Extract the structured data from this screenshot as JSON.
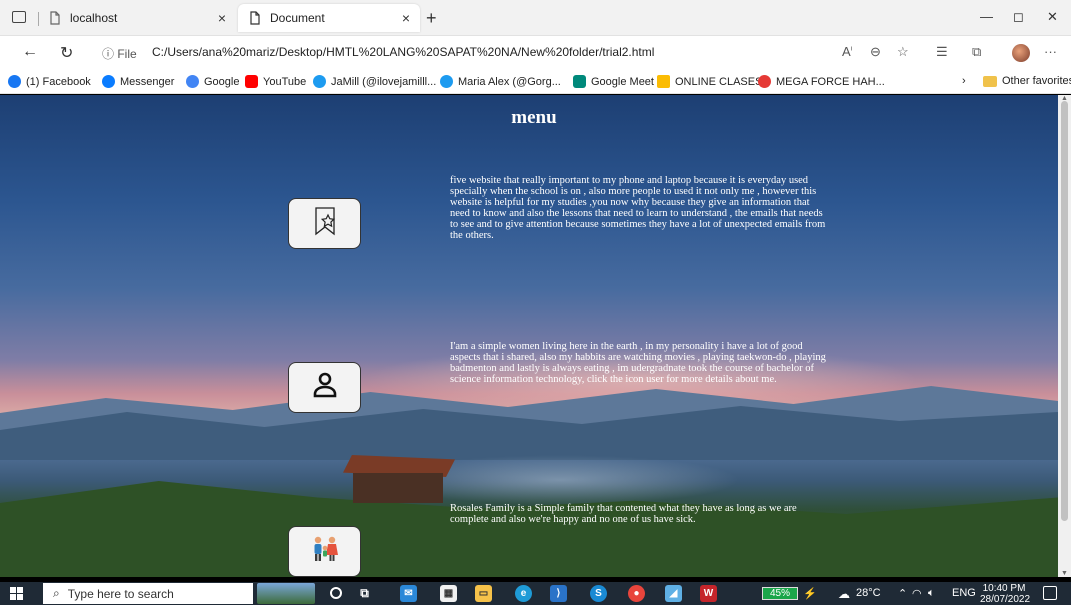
{
  "browser": {
    "tabs": [
      {
        "title": "localhost",
        "close": "×",
        "favicon": "file-icon"
      },
      {
        "title": "Document",
        "close": "×",
        "favicon": "document-icon"
      }
    ],
    "new_tab": "+",
    "window_controls": {
      "minimize": "—",
      "restore": "◻",
      "close": "✕"
    },
    "address": {
      "info_label": "ⓘ File",
      "url": "C:/Users/ana%20mariz/Desktop/HMTL%20LANG%20SAPAT%20NA/New%20folder/trial2.html"
    },
    "bookmarks": [
      {
        "label": "(1) Facebook",
        "color": "#1877f2"
      },
      {
        "label": "Messenger",
        "color": "#0a7cff"
      },
      {
        "label": "Google",
        "color": "#4285f4"
      },
      {
        "label": "YouTube",
        "color": "#ff0000"
      },
      {
        "label": "JaMill (@ilovejamilll...",
        "color": "#1d9bf0"
      },
      {
        "label": "Maria Alex (@Gorg...",
        "color": "#1d9bf0"
      },
      {
        "label": "Google Meet",
        "color": "#00897b"
      },
      {
        "label": "ONLINE CLASES",
        "color": "#fbbc04"
      },
      {
        "label": "MEGA FORCE HAH...",
        "color": "#e53935"
      }
    ],
    "other_favorites": "Other favorites"
  },
  "page": {
    "title": "menu",
    "sections": [
      {
        "icon": "bookmark-star-icon",
        "text": "five website that really important to my phone and laptop because it is everyday used specially when the school is on , also more people to used it not only me , however this website is helpful for my studies ,you now why because they give an information that need to know and also the lessons that need to learn to understand , the emails that needs to see and to give attention because sometimes they have a lot of unexpected emails from the others."
      },
      {
        "icon": "user-icon",
        "text": "I'am a simple women living here in the earth , in my personality i have a lot of good aspects that i shared, also my habbits are watching movies , playing taekwon-do , playing badmenton and lastly is always eating , im udergradnate took the course of bachelor of science information technology, click the icon user for more details about me."
      },
      {
        "icon": "family-icon",
        "text": "Rosales Family is a Simple family that contented what they have as long as we are complete and also we're happy and no one of us have sick."
      }
    ]
  },
  "taskbar": {
    "search_placeholder": "Type here to search",
    "battery": "45%",
    "temperature": "28°C",
    "language": "ENG",
    "time": "10:40 PM",
    "date": "28/07/2022"
  }
}
